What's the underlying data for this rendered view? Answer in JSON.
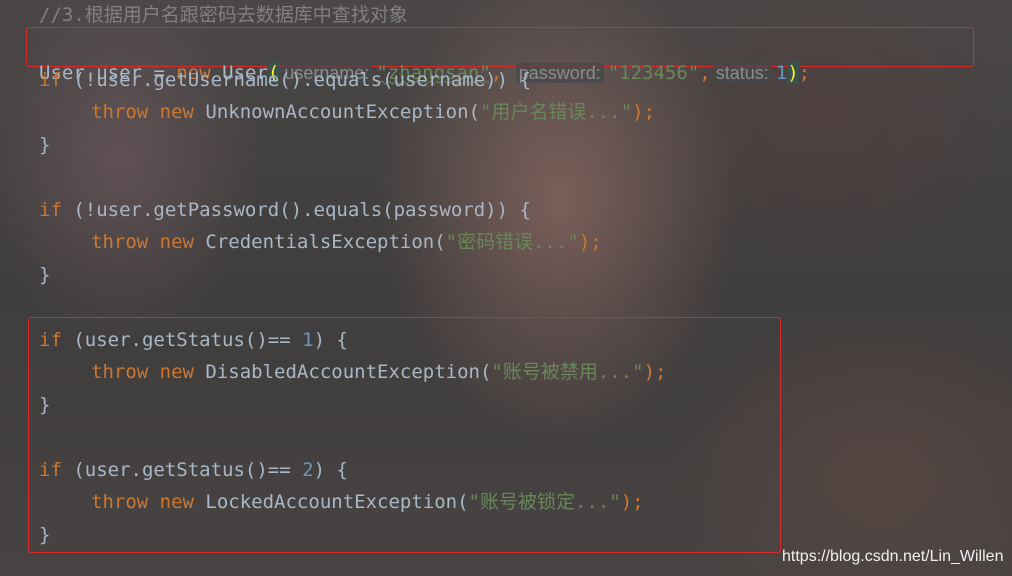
{
  "code": {
    "comment": "//3.根据用户名跟密码去数据库中查找对象",
    "line1": {
      "type": "User",
      "var": "user",
      "eq": "=",
      "kw_new": "new",
      "ctor": "User",
      "open": "(",
      "hint_username": "username:",
      "val_username": "\"zhangsan\"",
      "comma1": ",",
      "hint_password": "password:",
      "val_password": "\"123456\"",
      "comma2": ",",
      "hint_status": "status:",
      "val_status": "1",
      "close": ")",
      "semi": ";"
    },
    "if1": {
      "kw": "if",
      "cond": " (!user.getUsername().equals(username)) {",
      "throw": "throw",
      "new": "new",
      "exc": " UnknownAccountException(",
      "msg": "\"用户名错误...\"",
      "end": ");"
    },
    "if2": {
      "kw": "if",
      "cond": " (!user.getPassword().equals(password)) {",
      "throw": "throw",
      "new": "new",
      "exc": " CredentialsException(",
      "msg": "\"密码错误...\"",
      "end": ");"
    },
    "if3": {
      "kw": "if",
      "cond_pre": " (user.getStatus()== ",
      "num": "1",
      "cond_post": ") {",
      "throw": "throw",
      "new": "new",
      "exc": " DisabledAccountException(",
      "msg": "\"账号被禁用...\"",
      "end": ");"
    },
    "if4": {
      "kw": "if",
      "cond_pre": " (user.getStatus()== ",
      "num": "2",
      "cond_post": ") {",
      "throw": "throw",
      "new": "new",
      "exc": " LockedAccountException(",
      "msg": "\"账号被锁定...\"",
      "end": ");"
    },
    "brace": "}"
  },
  "watermark": "https://blog.csdn.net/Lin_Willen",
  "colors": {
    "keyword": "#cc7832",
    "string": "#6a8759",
    "number": "#6897bb",
    "comment": "#808080",
    "text": "#a9b7c6",
    "highlight_box": "#d92a2a"
  }
}
